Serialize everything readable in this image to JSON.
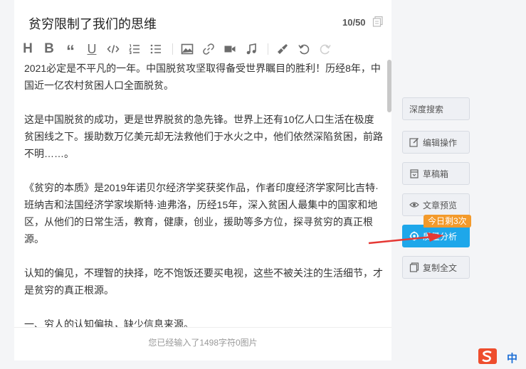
{
  "editor": {
    "title": "贫穷限制了我们的思维",
    "count": "10/50",
    "toolbar": {
      "heading": "H",
      "bold": "B",
      "quote": "“",
      "underline": "U"
    },
    "paragraphs": [
      "2021必定是不平凡的一年。中国脱贫攻坚取得备受世界瞩目的胜利！历经8年，中国近一亿农村贫困人口全面脱贫。",
      "这是中国脱贫的成功，更是世界脱贫的急先锋。世界上还有10亿人口生活在极度贫困线之下。援助数万亿美元却无法救他们于水火之中，他们依然深陷贫困，前路不明……。",
      "《贫穷的本质》是2019年诺贝尔经济学奖获奖作品，作者印度经济学家阿比吉特·班纳吉和法国经济学家埃斯特·迪弗洛，历经15年，深入贫困人最集中的国家和地区，从他们的日常生活，教育，健康，创业，援助等多方位，探寻贫穷的真正根源。",
      "认知的偏见，不理智的抉择，吃不饱饭还要买电视，这些不被关注的生活细节，才是贫穷的真正根源。",
      "一、穷人的认知偏执，缺少信息来源。"
    ],
    "footer": "您已经输入了1498字符0图片"
  },
  "sidebar": {
    "deep_search": "深度搜索",
    "edit_ops": "编辑操作",
    "drafts": "草稿箱",
    "preview": "文章预览",
    "quality": "质量分析",
    "quality_badge": "今日剩3次",
    "copy_all": "复制全文"
  },
  "ime": {
    "label": "中"
  },
  "colors": {
    "primary": "#1ea7ea",
    "badge": "#f39a2b",
    "arrow": "#e53935"
  }
}
